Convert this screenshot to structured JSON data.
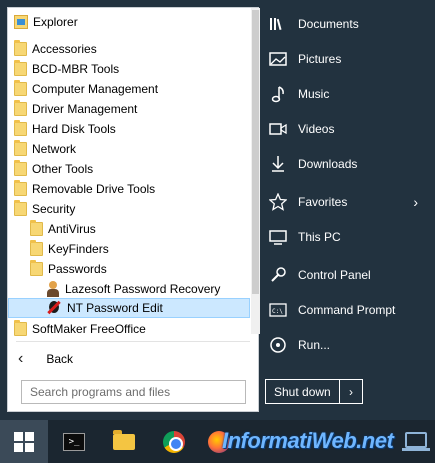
{
  "left_menu": {
    "items": [
      {
        "label": "Explorer",
        "icon": "explorer-icon",
        "indent": 0
      },
      {
        "label": "Accessories",
        "icon": "folder-icon",
        "indent": 0
      },
      {
        "label": "BCD-MBR Tools",
        "icon": "folder-icon",
        "indent": 0
      },
      {
        "label": "Computer Management",
        "icon": "folder-icon",
        "indent": 0
      },
      {
        "label": "Driver Management",
        "icon": "folder-icon",
        "indent": 0
      },
      {
        "label": "Hard Disk Tools",
        "icon": "folder-icon",
        "indent": 0
      },
      {
        "label": "Network",
        "icon": "folder-icon",
        "indent": 0
      },
      {
        "label": "Other Tools",
        "icon": "folder-icon",
        "indent": 0
      },
      {
        "label": "Removable Drive Tools",
        "icon": "folder-icon",
        "indent": 0
      },
      {
        "label": "Security",
        "icon": "folder-icon",
        "indent": 0
      },
      {
        "label": "AntiVirus",
        "icon": "folder-icon",
        "indent": 1
      },
      {
        "label": "KeyFinders",
        "icon": "folder-icon",
        "indent": 1
      },
      {
        "label": "Passwords",
        "icon": "folder-icon",
        "indent": 1
      },
      {
        "label": "Lazesoft Password Recovery",
        "icon": "lazesoft-icon",
        "indent": 2
      },
      {
        "label": "NT Password Edit",
        "icon": "nt-password-edit-icon",
        "indent": 2,
        "selected": true
      },
      {
        "label": "SoftMaker FreeOffice",
        "icon": "folder-icon",
        "indent": 0
      }
    ],
    "back_label": "Back",
    "search_placeholder": "Search programs and files"
  },
  "right_menu": {
    "items": [
      {
        "label": "Documents",
        "icon": "documents-icon"
      },
      {
        "label": "Pictures",
        "icon": "pictures-icon"
      },
      {
        "label": "Music",
        "icon": "music-icon"
      },
      {
        "label": "Videos",
        "icon": "videos-icon"
      },
      {
        "label": "Downloads",
        "icon": "downloads-icon"
      },
      {
        "label": "Favorites",
        "icon": "favorites-icon",
        "has_submenu": true
      },
      {
        "label": "This PC",
        "icon": "this-pc-icon"
      },
      {
        "label": "Control Panel",
        "icon": "control-panel-icon"
      },
      {
        "label": "Command Prompt",
        "icon": "command-prompt-icon"
      },
      {
        "label": "Run...",
        "icon": "run-icon"
      }
    ],
    "shutdown_label": "Shut down"
  },
  "taskbar": {
    "items": [
      "start-icon",
      "command-prompt-icon",
      "file-explorer-icon",
      "chrome-icon",
      "firefox-icon"
    ],
    "watermark": "InformatiWeb.net"
  },
  "colors": {
    "start_menu_bg": "#22323f",
    "selection_bg": "#cce8ff",
    "taskbar_bg": "#1b2630"
  }
}
